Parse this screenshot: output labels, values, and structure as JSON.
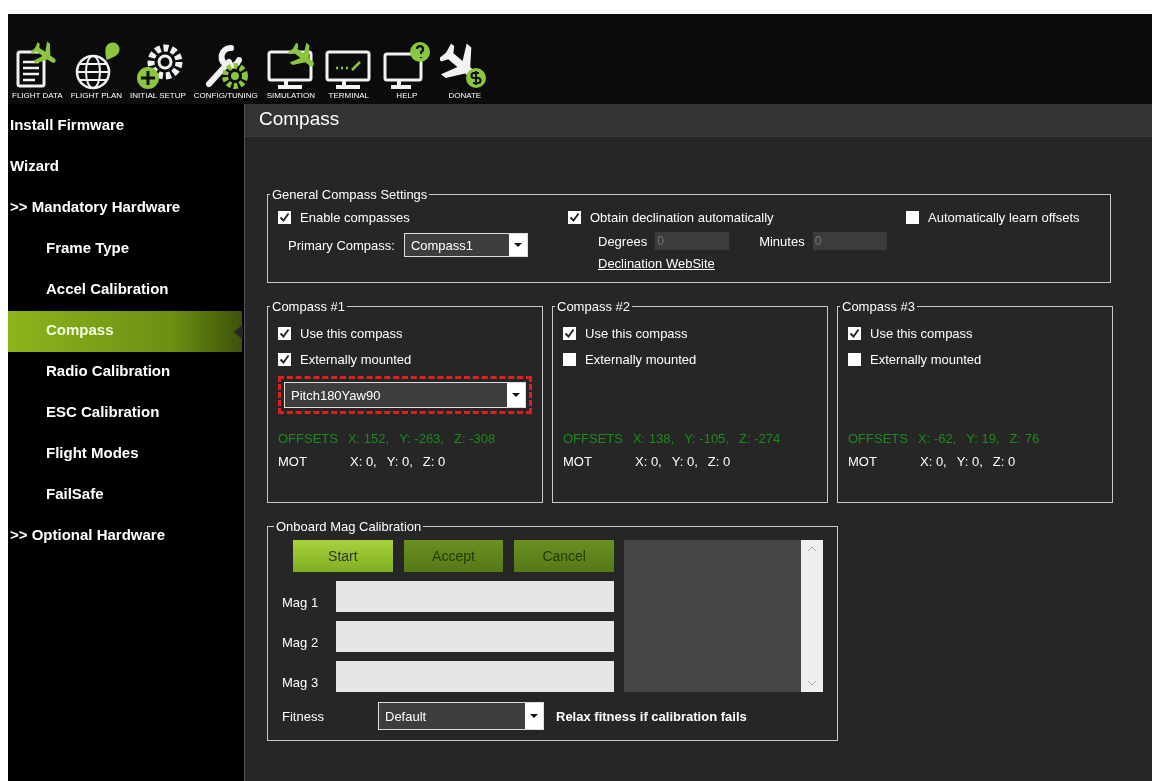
{
  "toolbar": [
    {
      "label": "FLIGHT DATA"
    },
    {
      "label": "FLIGHT PLAN"
    },
    {
      "label": "INITIAL SETUP"
    },
    {
      "label": "CONFIG/TUNING"
    },
    {
      "label": "SIMULATION"
    },
    {
      "label": "TERMINAL"
    },
    {
      "label": "HELP"
    },
    {
      "label": "DONATE"
    }
  ],
  "sidebar": {
    "items": [
      {
        "label": "Install Firmware",
        "kind": "top",
        "selected": false
      },
      {
        "label": "Wizard",
        "kind": "top",
        "selected": false
      },
      {
        "label": ">> Mandatory Hardware",
        "kind": "top",
        "selected": false
      },
      {
        "label": "Frame Type",
        "kind": "sub",
        "selected": false
      },
      {
        "label": "Accel Calibration",
        "kind": "sub",
        "selected": false
      },
      {
        "label": "Compass",
        "kind": "sub",
        "selected": true
      },
      {
        "label": "Radio Calibration",
        "kind": "sub",
        "selected": false
      },
      {
        "label": "ESC Calibration",
        "kind": "sub",
        "selected": false
      },
      {
        "label": "Flight Modes",
        "kind": "sub",
        "selected": false
      },
      {
        "label": "FailSafe",
        "kind": "sub",
        "selected": false
      },
      {
        "label": ">> Optional Hardware",
        "kind": "top",
        "selected": false
      }
    ]
  },
  "page_title": "Compass",
  "general": {
    "title": "General Compass Settings",
    "enable_compasses": {
      "label": "Enable compasses",
      "checked": true
    },
    "primary_compass": {
      "label": "Primary Compass:",
      "value": "Compass1"
    },
    "obtain_declination": {
      "label": "Obtain declination automatically",
      "checked": true
    },
    "degrees": {
      "label": "Degrees",
      "placeholder": "0",
      "disabled": true
    },
    "minutes": {
      "label": "Minutes",
      "placeholder": "0",
      "disabled": true
    },
    "website_link": "Declination WebSite",
    "auto_learn": {
      "label": "Automatically learn offsets",
      "checked": false
    }
  },
  "compasses": [
    {
      "title": "Compass #1",
      "use": {
        "label": "Use this compass",
        "checked": true
      },
      "external": {
        "label": "Externally mounted",
        "checked": true
      },
      "orientation": {
        "value": "Pitch180Yaw90",
        "highlighted": true
      },
      "offsets_label": "OFFSETS",
      "offsets": [
        "X: 152,",
        "Y: -263,",
        "Z: -308"
      ],
      "mot_label": "MOT",
      "mot": [
        "X: 0,",
        "Y: 0,",
        "Z: 0"
      ]
    },
    {
      "title": "Compass #2",
      "use": {
        "label": "Use this compass",
        "checked": true
      },
      "external": {
        "label": "Externally mounted",
        "checked": false
      },
      "offsets_label": "OFFSETS",
      "offsets": [
        "X: 138,",
        "Y: -105,",
        "Z: -274"
      ],
      "mot_label": "MOT",
      "mot": [
        "X: 0,",
        "Y: 0,",
        "Z: 0"
      ]
    },
    {
      "title": "Compass #3",
      "use": {
        "label": "Use this compass",
        "checked": true
      },
      "external": {
        "label": "Externally mounted",
        "checked": false
      },
      "offsets_label": "OFFSETS",
      "offsets": [
        "X: -62,",
        "Y: 19,",
        "Z: 76"
      ],
      "mot_label": "MOT",
      "mot": [
        "X: 0,",
        "Y: 0,",
        "Z: 0"
      ]
    }
  ],
  "onboard": {
    "title": "Onboard Mag Calibration",
    "buttons": [
      {
        "label": "Start",
        "disabled": false
      },
      {
        "label": "Accept",
        "disabled": true
      },
      {
        "label": "Cancel",
        "disabled": true
      }
    ],
    "mags": [
      {
        "label": "Mag 1",
        "level": 0
      },
      {
        "label": "Mag 2",
        "level": 0
      },
      {
        "label": "Mag 3",
        "level": 0
      }
    ],
    "fitness": {
      "label": "Fitness",
      "value": "Default"
    },
    "relax_label": "Relax fitness if calibration fails"
  }
}
